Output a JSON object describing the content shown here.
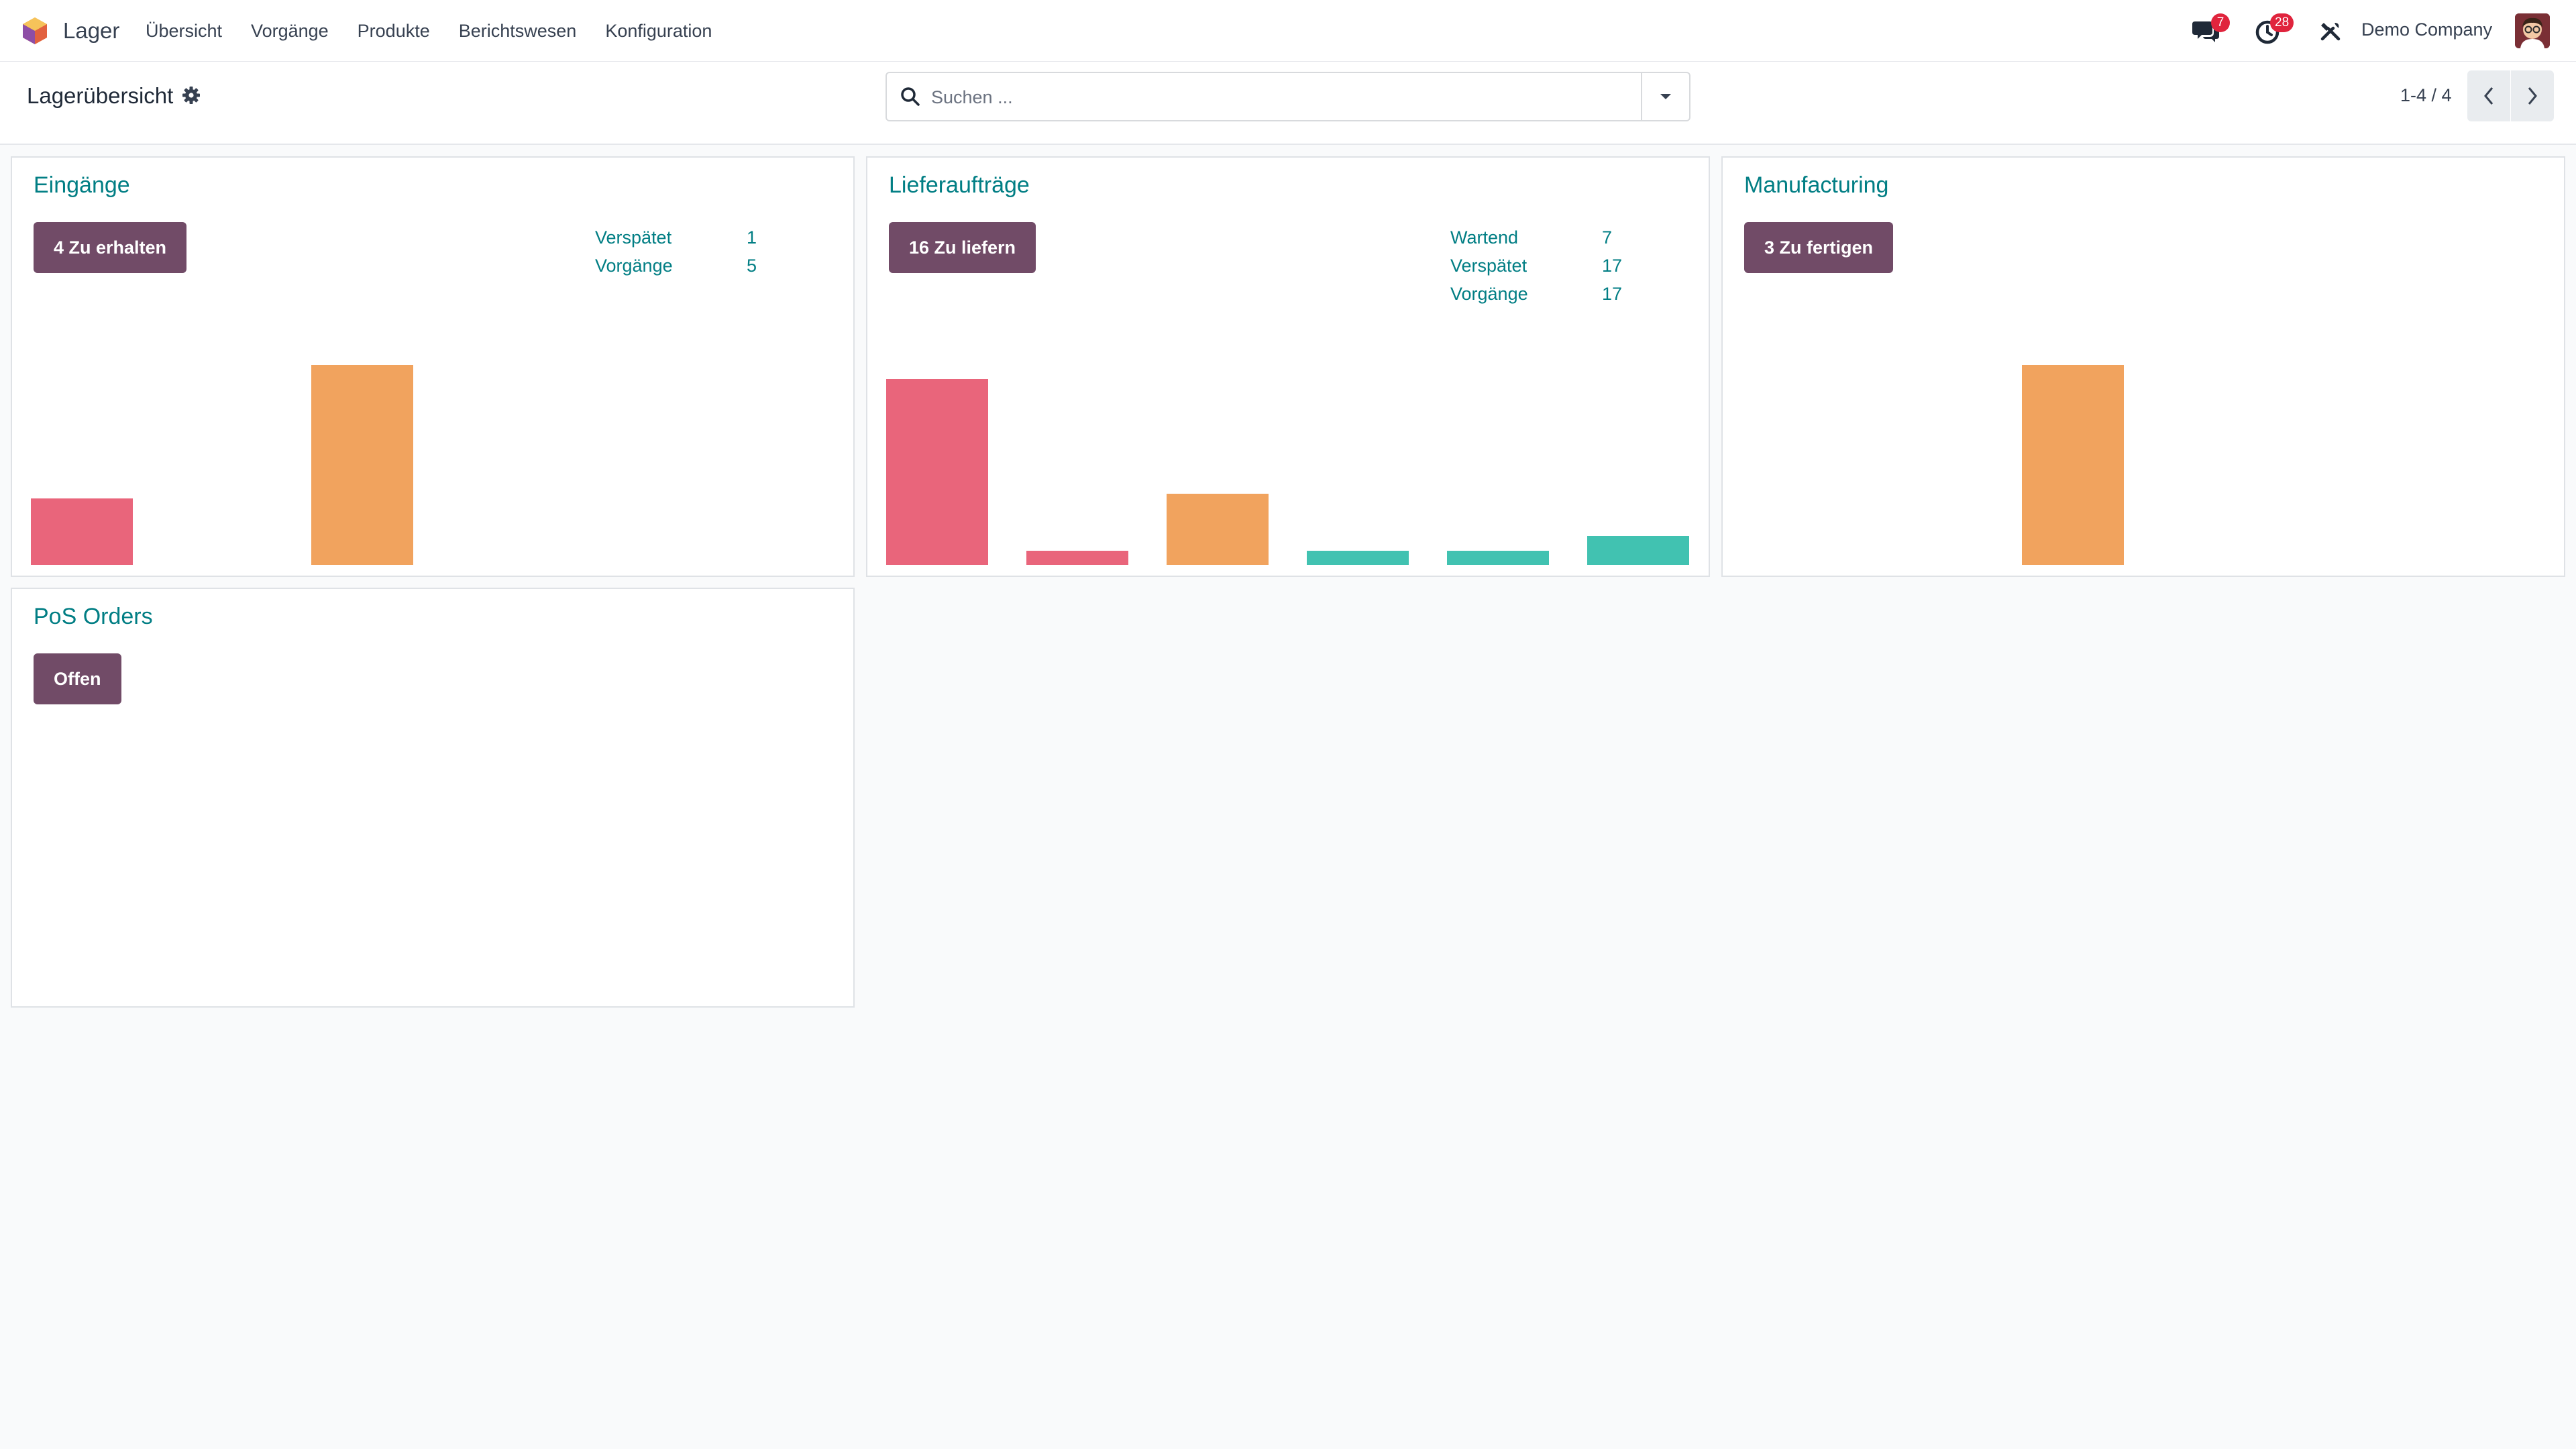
{
  "navbar": {
    "app_name": "Lager",
    "menu": [
      "Übersicht",
      "Vorgänge",
      "Produkte",
      "Berichtswesen",
      "Konfiguration"
    ],
    "messages_count": "7",
    "activities_count": "28",
    "company": "Demo Company"
  },
  "control_panel": {
    "title": "Lagerübersicht",
    "search_placeholder": "Suchen ...",
    "pager": "1-4 / 4"
  },
  "colors": {
    "late": "#e9657b",
    "today": "#f1a35e",
    "future": "#41c2b1",
    "primary": "#714b67",
    "link": "#017e84"
  },
  "cards": [
    {
      "title": "Eingänge",
      "button": "4 Zu erhalten",
      "stats": [
        {
          "label": "Verspätet",
          "value": "1"
        },
        {
          "label": "Vorgänge",
          "value": "5"
        }
      ],
      "chart_data": {
        "type": "bar",
        "categories": [
          "1",
          "2",
          "3",
          "4",
          "5",
          "6"
        ],
        "values": [
          1,
          0,
          3,
          0,
          0,
          0
        ],
        "colors": [
          "late",
          "late",
          "today",
          "future",
          "future",
          "future"
        ],
        "ylim": [
          0,
          3
        ]
      }
    },
    {
      "title": "Lieferaufträge",
      "button": "16 Zu liefern",
      "stats": [
        {
          "label": "Wartend",
          "value": "7"
        },
        {
          "label": "Verspätet",
          "value": "17"
        },
        {
          "label": "Vorgänge",
          "value": "17"
        }
      ],
      "chart_data": {
        "type": "bar",
        "categories": [
          "1",
          "2",
          "3",
          "4",
          "5",
          "6"
        ],
        "values": [
          13,
          1,
          5,
          1,
          1,
          2
        ],
        "colors": [
          "late",
          "late",
          "today",
          "future",
          "future",
          "future"
        ],
        "ylim": [
          0,
          14
        ]
      }
    },
    {
      "title": "Manufacturing",
      "button": "3 Zu fertigen",
      "stats": [],
      "chart_data": {
        "type": "bar",
        "categories": [
          "1",
          "2",
          "3",
          "4",
          "5",
          "6"
        ],
        "values": [
          0,
          0,
          3,
          0,
          0,
          0
        ],
        "colors": [
          "late",
          "late",
          "today",
          "future",
          "future",
          "future"
        ],
        "ylim": [
          0,
          3
        ]
      }
    },
    {
      "title": "PoS Orders",
      "button": "Offen",
      "stats": [],
      "chart_data": null
    }
  ]
}
